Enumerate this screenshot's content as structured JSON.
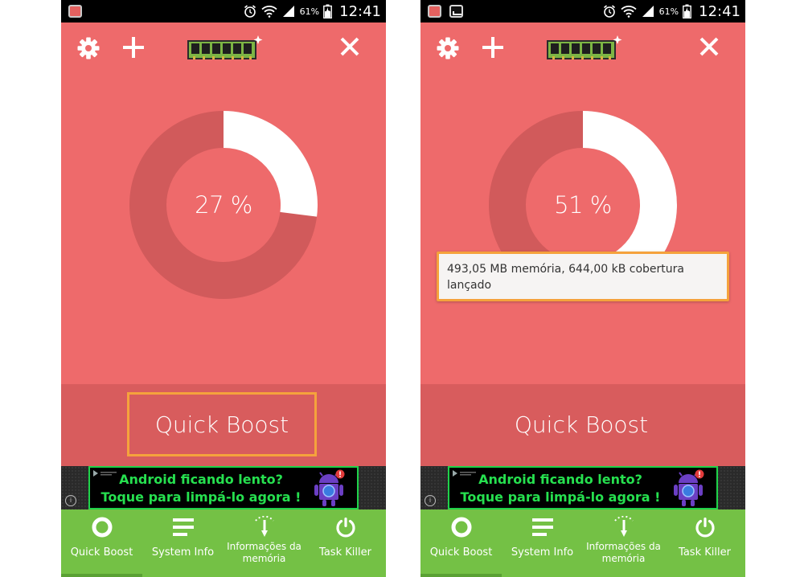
{
  "screens": [
    {
      "status_bar": {
        "battery_percent": "61%",
        "time": "12:41"
      },
      "memory_percent_label": "27 %",
      "memory_fraction": 0.27,
      "boost_button_label": "Quick Boost",
      "toast": null,
      "ad": {
        "line1": "Android ficando lento?",
        "line2": "Toque para limpá-lo agora !",
        "info": "i"
      },
      "nav": [
        {
          "label": "Quick Boost",
          "icon": "ring-icon"
        },
        {
          "label": "System Info",
          "icon": "list-icon"
        },
        {
          "label": "Informações da memória",
          "icon": "thermometer-icon"
        },
        {
          "label": "Task Killer",
          "icon": "power-icon"
        }
      ]
    },
    {
      "status_bar": {
        "battery_percent": "61%",
        "time": "12:41"
      },
      "memory_percent_label": "51 %",
      "memory_fraction": 0.51,
      "boost_button_label": "Quick Boost",
      "toast": {
        "line1": "493,05 MB memória, 644,00 kB cobertura",
        "line2": "lançado"
      },
      "ad": {
        "line1": "Android ficando lento?",
        "line2": "Toque para limpá-lo agora !",
        "info": "i"
      },
      "nav": [
        {
          "label": "Quick Boost",
          "icon": "ring-icon"
        },
        {
          "label": "System Info",
          "icon": "list-icon"
        },
        {
          "label": "Informações da memória",
          "icon": "thermometer-icon"
        },
        {
          "label": "Task Killer",
          "icon": "power-icon"
        }
      ]
    }
  ],
  "colors": {
    "background": "#ee6a6b",
    "gauge_track": "#d15a5b",
    "gauge_fill": "#ffffff",
    "boost_band": "#d85c5d",
    "highlight": "#f5a23c",
    "nav_bar": "#74c145",
    "ad_text": "#26e04f"
  }
}
